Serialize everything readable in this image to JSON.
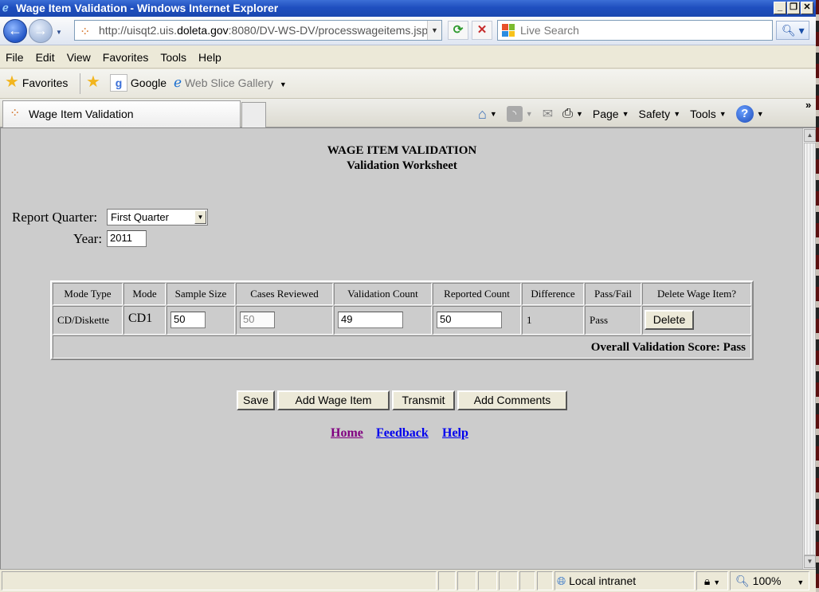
{
  "window": {
    "title": "Wage Item Validation - Windows Internet Explorer",
    "buttons": [
      "_",
      "❐",
      "✕"
    ]
  },
  "address": {
    "url_prefix": "http://uisqt2.uis.",
    "url_domain": "doleta.gov",
    "url_suffix": ":8080/DV-WS-DV/processwageitems.jsp",
    "search_placeholder": "Live Search"
  },
  "menu": [
    "File",
    "Edit",
    "View",
    "Favorites",
    "Tools",
    "Help"
  ],
  "favorites_bar": {
    "favorites_label": "Favorites",
    "google_label": "Google",
    "webslice_label": "Web Slice Gallery"
  },
  "tab": {
    "title": "Wage Item Validation"
  },
  "command_bar": {
    "page": "Page",
    "safety": "Safety",
    "tools": "Tools"
  },
  "page": {
    "heading": "WAGE ITEM VALIDATION",
    "subheading": "Validation Worksheet",
    "report_quarter_label": "Report Quarter:",
    "report_quarter_value": "First Quarter",
    "year_label": "Year:",
    "year_value": "2011"
  },
  "table": {
    "headers": [
      "Mode Type",
      "Mode",
      "Sample Size",
      "Cases Reviewed",
      "Validation Count",
      "Reported Count",
      "Difference",
      "Pass/Fail",
      "Delete Wage Item?"
    ],
    "row": {
      "mode_type": "CD/Diskette",
      "mode": "CD1",
      "sample_size": "50",
      "cases_reviewed": "50",
      "validation_count": "49",
      "reported_count": "50",
      "difference": "1",
      "pass_fail": "Pass",
      "delete_label": "Delete"
    },
    "overall_score": "Overall Validation Score: Pass"
  },
  "actions": {
    "save": "Save",
    "add_wage_item": "Add Wage Item",
    "transmit": "Transmit",
    "add_comments": "Add Comments"
  },
  "links": {
    "home": "Home",
    "feedback": "Feedback",
    "help": "Help"
  },
  "status": {
    "zone": "Local intranet",
    "zoom": "100%"
  },
  "colors": {
    "visited_link": "#800080",
    "link": "#0000ee",
    "titlebar": "#1f4fbf"
  }
}
